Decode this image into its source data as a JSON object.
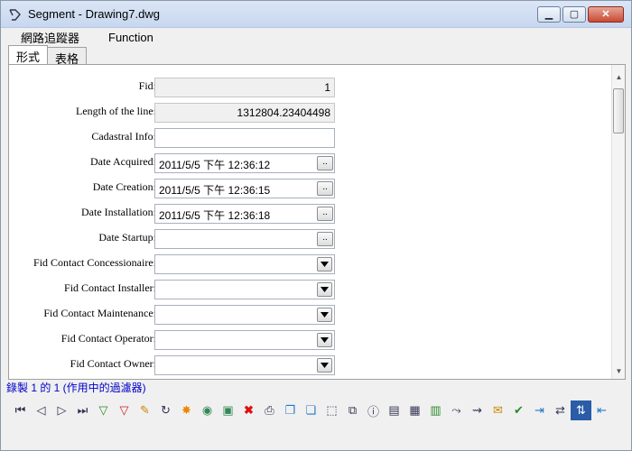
{
  "window": {
    "title": "Segment - Drawing7.dwg"
  },
  "menu": [
    "網路追蹤器",
    "Function"
  ],
  "tabs": [
    "形式",
    "表格"
  ],
  "fields": [
    {
      "label": "Fid:",
      "value": "1"
    },
    {
      "label": "Length of the line:",
      "value": "1312804.23404498"
    },
    {
      "label": "Cadastral Info:",
      "value": ""
    },
    {
      "label": "Date Acquired:",
      "value": "2011/5/5 下午 12:36:12"
    },
    {
      "label": "Date Creation:",
      "value": "2011/5/5 下午 12:36:15"
    },
    {
      "label": "Date Installation:",
      "value": "2011/5/5 下午 12:36:18"
    },
    {
      "label": "Date Startup:",
      "value": ""
    },
    {
      "label": "Fid Contact Concessionaire:",
      "value": ""
    },
    {
      "label": "Fid Contact Installer:",
      "value": ""
    },
    {
      "label": "Fid Contact Maintenance:",
      "value": ""
    },
    {
      "label": "Fid Contact Operator:",
      "value": ""
    },
    {
      "label": "Fid Contact Owner:",
      "value": ""
    }
  ],
  "ellipsis_label": "..",
  "status": "錄製 1 的 1 (作用中的過濾器)",
  "toolbar_icons": [
    "first-record-icon",
    "previous-record-icon",
    "next-record-icon",
    "last-record-icon",
    "add-filter-icon",
    "remove-filter-icon",
    "edit-pencil-icon",
    "refresh-icon",
    "highlight-icon",
    "zoom-globe-icon",
    "select-icon",
    "delete-icon",
    "print-icon",
    "copy-icon",
    "copy-all-icon",
    "select-box-icon",
    "duplicate-icon",
    "info-icon",
    "document-icon",
    "export-icon",
    "report-icon",
    "trace-icon",
    "trace-network-icon",
    "new-document-icon",
    "validate-icon",
    "connect-icon",
    "transfer-icon",
    "sort-icon",
    "exit-icon"
  ]
}
